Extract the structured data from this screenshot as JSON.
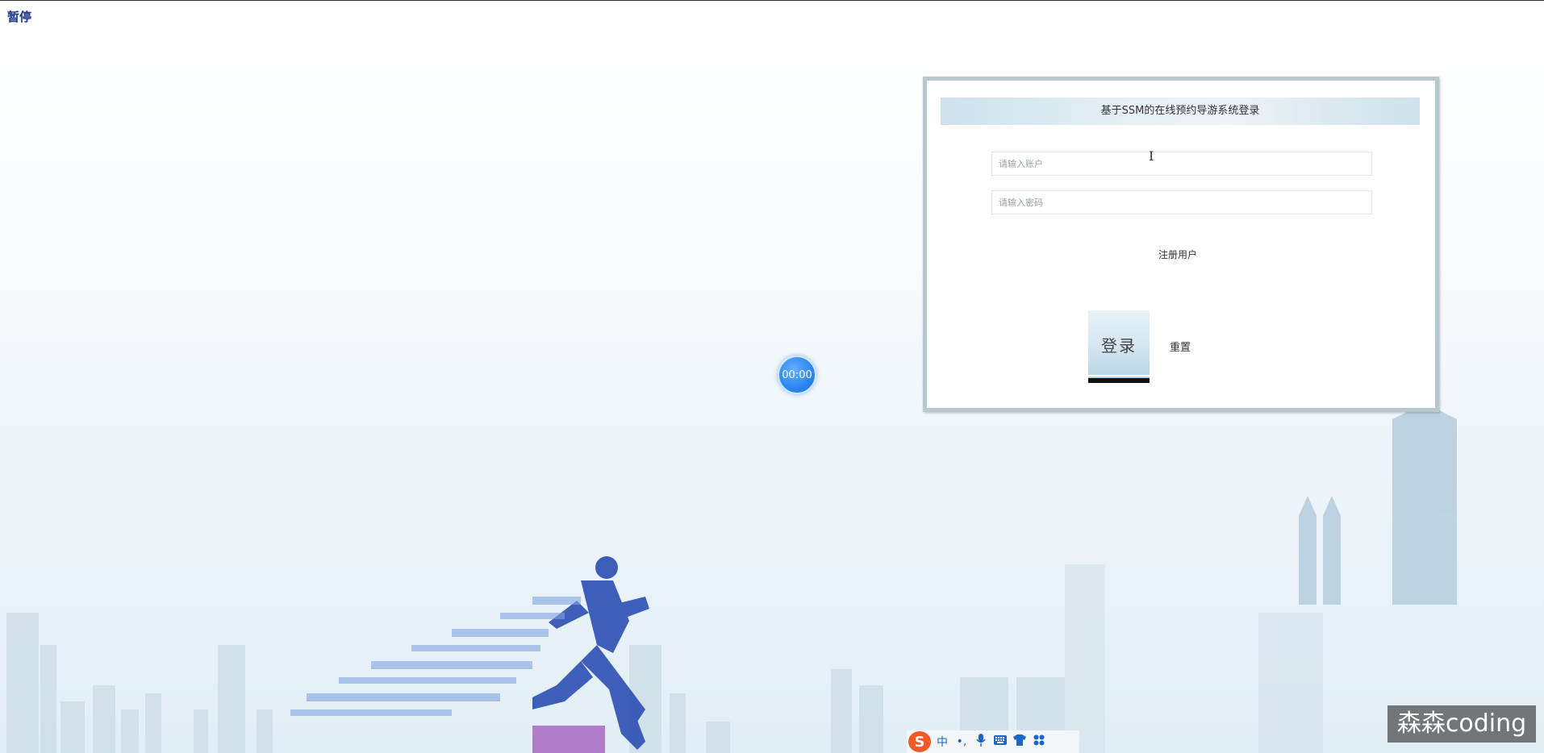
{
  "player": {
    "pause_label": "暂停",
    "timer": "00:00"
  },
  "login": {
    "title": "基于SSM的在线预约导游系统登录",
    "account_placeholder": "请输入账户",
    "password_placeholder": "请输入密码",
    "register_label": "注册用户",
    "login_label": "登录",
    "reset_label": "重置"
  },
  "ime": {
    "logo": "S",
    "items": [
      "中",
      "•,",
      "mic-icon",
      "keyboard-icon",
      "shirt-icon",
      "grid-icon"
    ]
  },
  "watermark": {
    "text": "森森coding"
  },
  "colors": {
    "accent": "#2b86ee",
    "panel_border": "#b8c8cc",
    "ime_logo": "#f15a24"
  }
}
